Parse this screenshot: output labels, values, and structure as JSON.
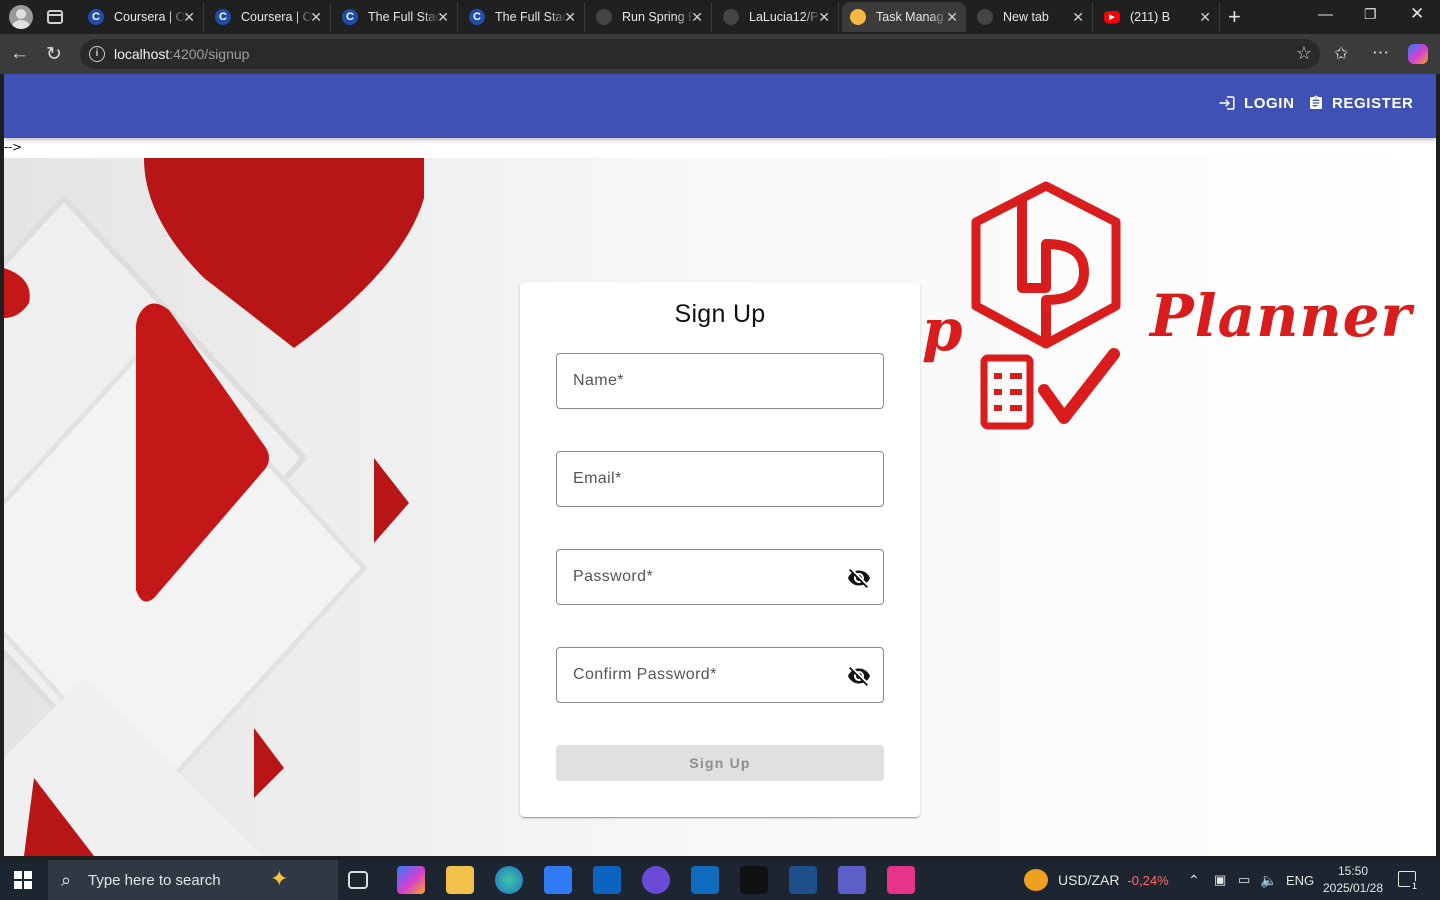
{
  "browser": {
    "tabs": [
      {
        "title": "Coursera | O",
        "icon": "coursera-icon",
        "color": "#1f4ea8"
      },
      {
        "title": "Coursera | O",
        "icon": "coursera-icon",
        "color": "#1f4ea8"
      },
      {
        "title": "The Full Stac",
        "icon": "coursera-icon",
        "color": "#1f4ea8"
      },
      {
        "title": "The Full Stac",
        "icon": "coursera-icon",
        "color": "#1f4ea8"
      },
      {
        "title": "Run Spring B",
        "icon": "openai-icon",
        "color": "#444444"
      },
      {
        "title": "LaLucia12/P",
        "icon": "github-icon",
        "color": "#444444"
      },
      {
        "title": "Task Manag",
        "icon": "app-icon",
        "color": "#f5b942"
      },
      {
        "title": "New tab",
        "icon": "newtab-icon",
        "color": "#444444"
      },
      {
        "title": "(211) B",
        "icon": "youtube-icon",
        "color": "#ff0000"
      }
    ],
    "active_tab_index": 6,
    "url_host": "localhost",
    "url_path": ":4200/signup"
  },
  "appbar": {
    "login_label": "LOGIN",
    "register_label": "REGISTER",
    "color": "#3f51b5"
  },
  "stray_text": "-->",
  "logo": {
    "text": "Planner",
    "partial_text": "p",
    "color": "#d91c1c"
  },
  "signup": {
    "title": "Sign Up",
    "name_placeholder": "Name*",
    "email_placeholder": "Email*",
    "password_placeholder": "Password*",
    "confirm_placeholder": "Confirm Password*",
    "submit_label": "Sign Up"
  },
  "taskbar": {
    "search_placeholder": "Type here to search",
    "currency_label": "USD/ZAR",
    "currency_change": "-0,24%",
    "language": "ENG",
    "time": "15:50",
    "date": "2025/01/28",
    "notification_count": "1"
  }
}
